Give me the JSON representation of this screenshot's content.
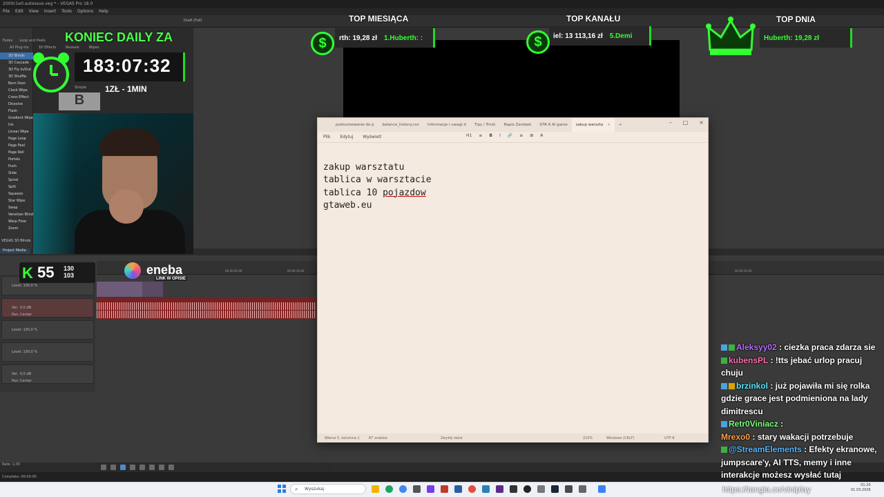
{
  "vegas": {
    "title": "2000c1e0.autosave.veg * - VEGAS Pro 18.0",
    "menu": [
      "File",
      "Edit",
      "View",
      "Insert",
      "Tools",
      "Options",
      "Help"
    ],
    "fx_tabs": [
      "Fades",
      "Loop and Peels",
      "All Plug-ins",
      "3D Effects",
      "Reveals",
      "Wipes"
    ],
    "fx_items": [
      "3D Blinds",
      "3D Cascade",
      "3D Fly In/Out",
      "3D Shuffle",
      "Barn Door",
      "Clock Wipe",
      "Cross Effect",
      "Dissolve",
      "Flash",
      "Gradient Wipe",
      "Iris",
      "Linear Wipe",
      "Page Loop",
      "Page Peel",
      "Page Roll",
      "Portals",
      "Push",
      "Slide",
      "Spiral",
      "Split",
      "Squeeze",
      "Star Wipe",
      "Swap",
      "Venetian Blinds",
      "Warp Flow",
      "Zoom"
    ],
    "selected_fx": "VEGAS 3D Blinds",
    "project_media": "Project Media",
    "draft": "Draft (Full)",
    "simple": "Simple",
    "level1": "Level: 100,0 %",
    "vol": "Vol:",
    "vol_val": "0,0 dB",
    "pan": "Pan:",
    "pan_val": "Center",
    "rate": "Rate: 1,00",
    "complete": "Complete: 00:00:00",
    "ruler_marks": [
      "00:00:00:00",
      "00:00:05:00",
      "00:00:10:00",
      "00:00:15:00"
    ]
  },
  "overlay": {
    "daily_title": "KONIEC DAILY ZA",
    "timer": "183:07:32",
    "rate_text": "1ZŁ - 1MIN",
    "thumb_letter": "B",
    "top_month_title": "TOP MIESIĄCA",
    "top_month_a": "rth: 19,28 zł",
    "top_month_b": "1.Huberth: :",
    "top_channel_title": "TOP KANAŁU",
    "top_channel_a": "iel: 13 113,16 zł",
    "top_channel_b": "5.Demi",
    "top_day_title": "TOP DNIA",
    "top_day_a": "Huberth: 19,28 zł",
    "coin_symbol": "$",
    "k_letter": "K",
    "k_num": "55",
    "k_side_top": "130",
    "k_side_bottom": "103",
    "eneba": "eneba",
    "eneba_sub": "LINK W OPISIE"
  },
  "notepad": {
    "tabs": [
      "podsumowanie do p",
      "balance_history.csv",
      "Informacje i uwagi d",
      "Tipy i Tricki",
      "Napis Zarobek",
      "GTA 6 AI game",
      "zakup warszta"
    ],
    "active_tab": "zakup warszta",
    "menu": [
      "Plik",
      "Edytuj",
      "Wyświetl"
    ],
    "toolbar": [
      "H1",
      "≡",
      "B",
      "I",
      "🔗",
      "≡",
      "⊞",
      "A"
    ],
    "lines": [
      "zakup warsztatu",
      "tablica w warsztacie",
      "tablica 10 ",
      "pojazdow",
      "gtaweb.eu"
    ],
    "status_pos": "Wiersz 5, kolumna 1",
    "status_chars": "87 znaków",
    "status_fmt": "Zwykły tekst",
    "status_zoom": "210%",
    "status_eol": "Windows (CRLF)",
    "status_enc": "UTF-8"
  },
  "chat": [
    {
      "user": "Aleksyy02",
      "color": "#b56cff",
      "text": " : ciezka praca zdarza sie"
    },
    {
      "user": "kubensPL",
      "color": "#ff6fb0",
      "text": " : !tts jebać urlop pracuj chuju"
    },
    {
      "user": "brzinkol",
      "color": "#57e8ff",
      "text": " : już pojawiła mi się rolka gdzie grace jest podmieniona na lady dimitrescu"
    },
    {
      "user": "Retr0Viniacz",
      "color": "#7dff7d",
      "text": " : "
    },
    {
      "user": "Mrexo0",
      "color": "#ffa24a",
      "text": " : stary wakacji potrzebuje"
    },
    {
      "user": "@StreamElements",
      "color": "#57b8ff",
      "text": " : Efekty ekranowe, jumpscare'y, AI TTS, memy i inne interakcje możesz wysłać tutaj"
    }
  ],
  "taskbar": {
    "search": "Wyszukaj",
    "time": "01:20",
    "date": "01.03.2026",
    "tangia": "https://tangia.co/viniplay"
  },
  "colors": {
    "accent_green": "#33ff33",
    "notepad_bg": "#f5eadf"
  }
}
